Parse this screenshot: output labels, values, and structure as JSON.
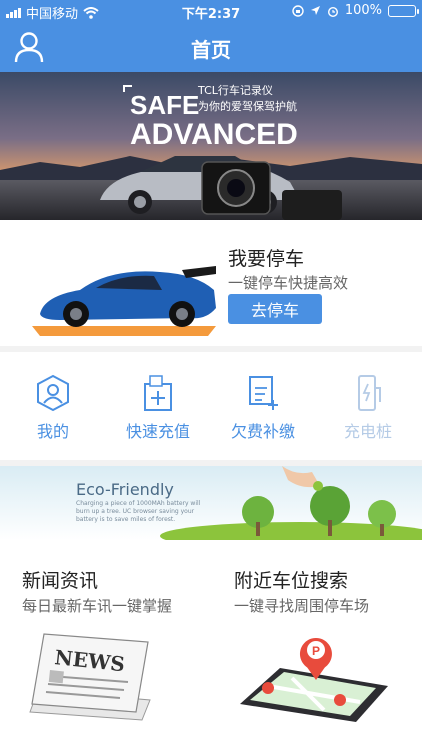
{
  "status": {
    "carrier": "中国移动",
    "time": "下午2:37",
    "battery": "100%",
    "battery_level": 1.0
  },
  "nav": {
    "title": "首页"
  },
  "banner1": {
    "headline1": "SAFE",
    "headline2": "ADVANCED",
    "brand": "TCL行车记录仪",
    "slogan": "为你的爱驾保驾护航"
  },
  "parking": {
    "title": "我要停车",
    "subtitle": "一键停车快捷高效",
    "button": "去停车"
  },
  "menu": [
    {
      "label": "我的",
      "icon": "user-icon"
    },
    {
      "label": "快速充值",
      "icon": "recharge-icon"
    },
    {
      "label": "欠费补缴",
      "icon": "bill-icon"
    },
    {
      "label": "充电桩",
      "icon": "charging-pile-icon"
    }
  ],
  "banner2": {
    "title": "Eco-Friendly",
    "subtitle": "Charging a piece of 1000MAh battery will burn up a tree. UC browser saving your battery is to save miles of forest."
  },
  "news": {
    "title": "新闻资讯",
    "subtitle": "每日最新车讯一键掌握",
    "image_text": "NEWS"
  },
  "nearby": {
    "title": "附近车位搜索",
    "subtitle": "一键寻找周围停车场"
  },
  "colors": {
    "brand": "#4a90e2",
    "disabled": "#b5cbe6"
  }
}
